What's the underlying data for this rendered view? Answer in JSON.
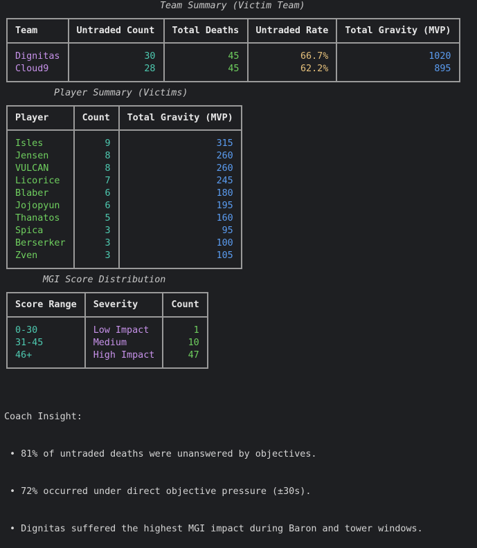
{
  "team_summary": {
    "caption": "Team Summary (Victim Team)",
    "headers": [
      "Team",
      "Untraded Count",
      "Total Deaths",
      "Untraded Rate",
      "Total Gravity (MVP)"
    ],
    "rows": [
      [
        "Dignitas",
        "30",
        "45",
        "66.7%",
        "1020"
      ],
      [
        "Cloud9",
        "28",
        "45",
        "62.2%",
        "895"
      ]
    ]
  },
  "player_summary": {
    "caption": "Player Summary (Victims)",
    "headers": [
      "Player",
      "Count",
      "Total Gravity (MVP)"
    ],
    "rows": [
      [
        "Isles",
        "9",
        "315"
      ],
      [
        "Jensen",
        "8",
        "260"
      ],
      [
        "VULCAN",
        "8",
        "260"
      ],
      [
        "Licorice",
        "7",
        "245"
      ],
      [
        "Blaber",
        "6",
        "180"
      ],
      [
        "Jojopyun",
        "6",
        "195"
      ],
      [
        "Thanatos",
        "5",
        "160"
      ],
      [
        "Spica",
        "3",
        "95"
      ],
      [
        "Berserker",
        "3",
        "100"
      ],
      [
        "Zven",
        "3",
        "105"
      ]
    ]
  },
  "mgi_distribution": {
    "caption": "MGI Score Distribution",
    "headers": [
      "Score Range",
      "Severity",
      "Count"
    ],
    "rows": [
      [
        "0-30",
        "Low Impact",
        "1"
      ],
      [
        "31-45",
        "Medium",
        "10"
      ],
      [
        "46+",
        "High Impact",
        "47"
      ]
    ]
  },
  "coach_insight": {
    "title": "Coach Insight:",
    "bullets": [
      " • 81% of untraded deaths were unanswered by objectives.",
      " • 72% occurred under direct objective pressure (±30s).",
      " • Dignitas suffered the highest MGI impact during Baron and tower windows."
    ]
  },
  "colors": {
    "background": "#1e1f22",
    "border": "#9a9a9a",
    "purple": "#c792ea",
    "teal": "#4ec9b0",
    "green": "#6fcf5f",
    "yellow": "#e5c07b",
    "blue": "#5b9cf0"
  }
}
